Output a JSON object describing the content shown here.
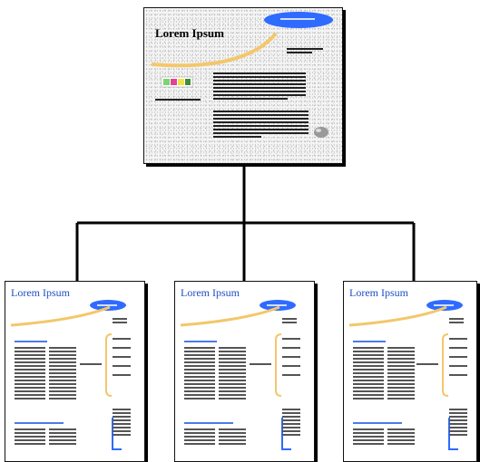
{
  "diagram": {
    "top_page": {
      "title": "Lorem Ipsum"
    },
    "child_pages": [
      {
        "title": "Lorem Ipsum"
      },
      {
        "title": "Lorem Ipsum"
      },
      {
        "title": "Lorem Ipsum"
      }
    ],
    "colors": {
      "title_blue": "#1e4fc2",
      "accent_blue": "#2f6bff",
      "accent_yellow": "#f3c76a",
      "connector": "#000000"
    }
  }
}
